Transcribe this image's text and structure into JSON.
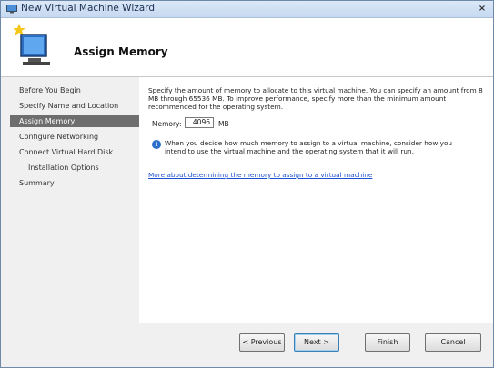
{
  "window": {
    "title": "New Virtual Machine Wizard",
    "close_glyph": "×"
  },
  "header": {
    "title": "Assign Memory",
    "icon": "computer-wizard-icon"
  },
  "nav": {
    "items": [
      {
        "label": "Before You Begin"
      },
      {
        "label": "Specify Name and Location"
      },
      {
        "label": "Assign Memory"
      },
      {
        "label": "Configure Networking"
      },
      {
        "label": "Connect Virtual Hard Disk"
      },
      {
        "label": "Installation Options"
      },
      {
        "label": "Summary"
      }
    ],
    "selected": "Assign Memory"
  },
  "content": {
    "description": "Specify the amount of memory to allocate to this virtual machine. You can specify an amount from 8 MB through 65536 MB. To improve performance, specify more than the minimum amount recommended for the operating system.",
    "memory_label": "Memory:",
    "memory_value": "4096",
    "memory_unit": "MB",
    "info_text": "When you decide how much memory to assign to a virtual machine, consider how you intend to use the virtual machine and the operating system that it will run.",
    "more_link": "More about determining the memory to assign to a virtual machine"
  },
  "buttons": {
    "previous": "< Previous",
    "next": "Next >",
    "finish": "Finish",
    "cancel": "Cancel"
  },
  "colors": {
    "selected_nav": "#6e6e6e",
    "link": "#1a4fd0",
    "info": "#2a6fc9"
  }
}
